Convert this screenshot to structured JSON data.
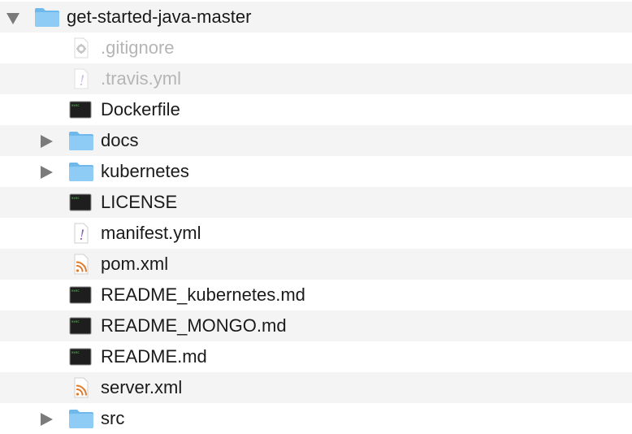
{
  "root": {
    "name": "get-started-java-master",
    "expanded": true
  },
  "items": [
    {
      "name": ".gitignore",
      "kind": "gear-file",
      "hidden": true
    },
    {
      "name": ".travis.yml",
      "kind": "yaml-file",
      "hidden": true
    },
    {
      "name": "Dockerfile",
      "kind": "exec-file"
    },
    {
      "name": "docs",
      "kind": "folder",
      "expanded": false
    },
    {
      "name": "kubernetes",
      "kind": "folder",
      "expanded": false
    },
    {
      "name": "LICENSE",
      "kind": "exec-file"
    },
    {
      "name": "manifest.yml",
      "kind": "yaml-file"
    },
    {
      "name": "pom.xml",
      "kind": "rss-file"
    },
    {
      "name": "README_kubernetes.md",
      "kind": "exec-file"
    },
    {
      "name": "README_MONGO.md",
      "kind": "exec-file"
    },
    {
      "name": "README.md",
      "kind": "exec-file"
    },
    {
      "name": "server.xml",
      "kind": "rss-file"
    },
    {
      "name": "src",
      "kind": "folder",
      "expanded": false
    }
  ],
  "colors": {
    "folder": "#8ecbf5",
    "folder_tab": "#6fb8ec",
    "exec_bg": "#1e1e1e",
    "exec_text": "#55d255",
    "rss": "#e07b2c",
    "yaml_mark": "#8a5fb8",
    "hidden_text": "#b5b5b5"
  }
}
